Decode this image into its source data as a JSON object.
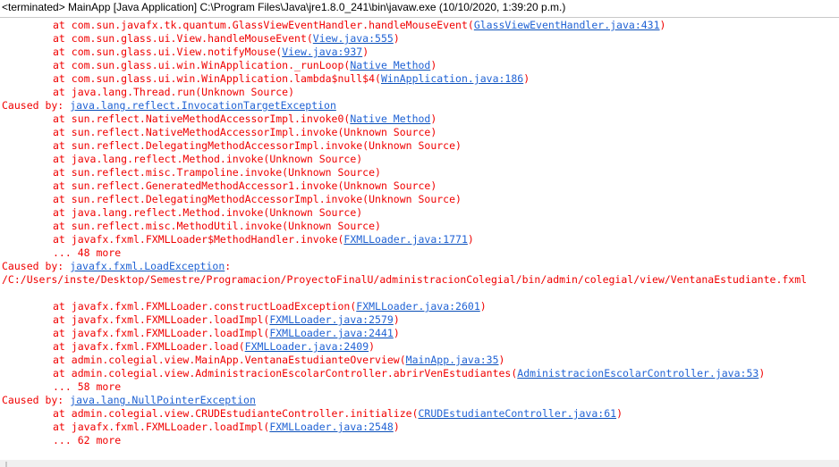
{
  "header": {
    "title": "<terminated> MainApp [Java Application] C:\\Program Files\\Java\\jre1.8.0_241\\bin\\javaw.exe (10/10/2020, 1:39:20 p.m.)"
  },
  "colors": {
    "error_text": "#f00000",
    "link": "#1f62d4"
  },
  "console": {
    "lines": [
      {
        "indent": true,
        "pre": "at com.sun.javafx.tk.quantum.GlassViewEventHandler.handleMouseEvent(",
        "link": "GlassViewEventHandler.java:431",
        "post": ")"
      },
      {
        "indent": true,
        "pre": "at com.sun.glass.ui.View.handleMouseEvent(",
        "link": "View.java:555",
        "post": ")"
      },
      {
        "indent": true,
        "pre": "at com.sun.glass.ui.View.notifyMouse(",
        "link": "View.java:937",
        "post": ")"
      },
      {
        "indent": true,
        "pre": "at com.sun.glass.ui.win.WinApplication._runLoop(",
        "link": "Native Method",
        "post": ")"
      },
      {
        "indent": true,
        "pre": "at com.sun.glass.ui.win.WinApplication.lambda$null$4(",
        "link": "WinApplication.java:186",
        "post": ")"
      },
      {
        "indent": true,
        "pre": "at java.lang.Thread.run(Unknown Source)"
      },
      {
        "indent": false,
        "pre": "Caused by: ",
        "link": "java.lang.reflect.InvocationTargetException"
      },
      {
        "indent": true,
        "pre": "at sun.reflect.NativeMethodAccessorImpl.invoke0(",
        "link": "Native Method",
        "post": ")"
      },
      {
        "indent": true,
        "pre": "at sun.reflect.NativeMethodAccessorImpl.invoke(Unknown Source)"
      },
      {
        "indent": true,
        "pre": "at sun.reflect.DelegatingMethodAccessorImpl.invoke(Unknown Source)"
      },
      {
        "indent": true,
        "pre": "at java.lang.reflect.Method.invoke(Unknown Source)"
      },
      {
        "indent": true,
        "pre": "at sun.reflect.misc.Trampoline.invoke(Unknown Source)"
      },
      {
        "indent": true,
        "pre": "at sun.reflect.GeneratedMethodAccessor1.invoke(Unknown Source)"
      },
      {
        "indent": true,
        "pre": "at sun.reflect.DelegatingMethodAccessorImpl.invoke(Unknown Source)"
      },
      {
        "indent": true,
        "pre": "at java.lang.reflect.Method.invoke(Unknown Source)"
      },
      {
        "indent": true,
        "pre": "at sun.reflect.misc.MethodUtil.invoke(Unknown Source)"
      },
      {
        "indent": true,
        "pre": "at javafx.fxml.FXMLLoader$MethodHandler.invoke(",
        "link": "FXMLLoader.java:1771",
        "post": ")"
      },
      {
        "indent": true,
        "pre": "... 48 more"
      },
      {
        "indent": false,
        "pre": "Caused by: ",
        "link": "javafx.fxml.LoadException",
        "post": ":"
      },
      {
        "indent": false,
        "pre": "/C:/Users/inste/Desktop/Semestre/Programacion/ProyectoFinalU/administracionColegial/bin/admin/colegial/view/VentanaEstudiante.fxml"
      },
      {
        "indent": false,
        "pre": ""
      },
      {
        "indent": true,
        "pre": "at javafx.fxml.FXMLLoader.constructLoadException(",
        "link": "FXMLLoader.java:2601",
        "post": ")"
      },
      {
        "indent": true,
        "pre": "at javafx.fxml.FXMLLoader.loadImpl(",
        "link": "FXMLLoader.java:2579",
        "post": ")"
      },
      {
        "indent": true,
        "pre": "at javafx.fxml.FXMLLoader.loadImpl(",
        "link": "FXMLLoader.java:2441",
        "post": ")"
      },
      {
        "indent": true,
        "pre": "at javafx.fxml.FXMLLoader.load(",
        "link": "FXMLLoader.java:2409",
        "post": ")"
      },
      {
        "indent": true,
        "pre": "at admin.colegial.view.MainApp.VentanaEstudianteOverview(",
        "link": "MainApp.java:35",
        "post": ")"
      },
      {
        "indent": true,
        "pre": "at admin.colegial.view.AdministracionEscolarController.abrirVenEstudiantes(",
        "link": "AdministracionEscolarController.java:53",
        "post": ")"
      },
      {
        "indent": true,
        "pre": "... 58 more"
      },
      {
        "indent": false,
        "pre": "Caused by: ",
        "link": "java.lang.NullPointerException"
      },
      {
        "indent": true,
        "pre": "at admin.colegial.view.CRUDEstudianteController.initialize(",
        "link": "CRUDEstudianteController.java:61",
        "post": ")"
      },
      {
        "indent": true,
        "pre": "at javafx.fxml.FXMLLoader.loadImpl(",
        "link": "FXMLLoader.java:2548",
        "post": ")"
      },
      {
        "indent": true,
        "pre": "... 62 more"
      }
    ]
  }
}
